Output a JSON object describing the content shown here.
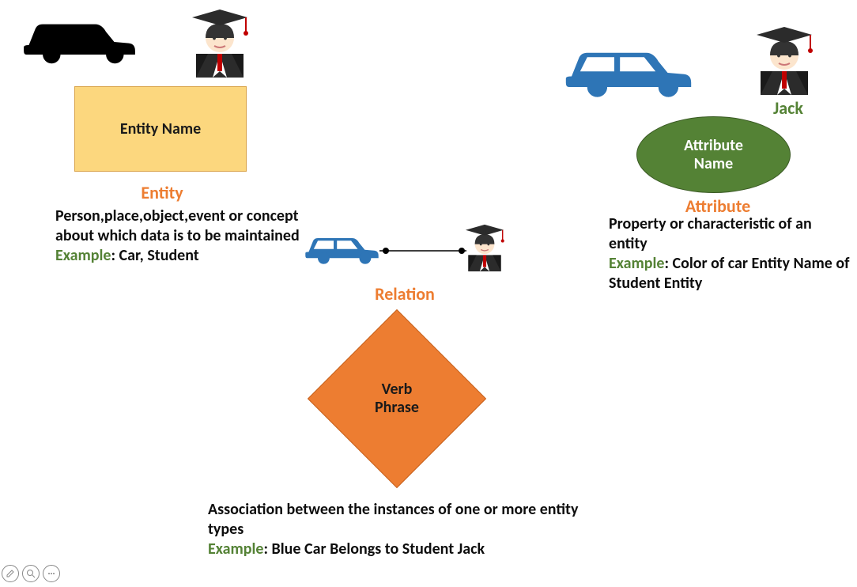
{
  "entity": {
    "shape_label": "Entity Name",
    "heading": "Entity",
    "description": "Person,place,object,event or concept about which data is to be maintained",
    "example_prefix": "Example",
    "example_text": ": Car, Student"
  },
  "attribute": {
    "shape_label": "Attribute Name",
    "heading": "Attribute",
    "jack_label": "Jack",
    "description": "Property or characteristic of an entity",
    "example_prefix": "Example",
    "example_text": ": Color of car Entity Name of Student Entity"
  },
  "relation": {
    "shape_label": "Verb Phrase",
    "heading": "Relation",
    "description": "Association between the instances of one or more entity types",
    "example_prefix": "Example",
    "example_text": ": Blue Car Belongs to Student Jack"
  }
}
